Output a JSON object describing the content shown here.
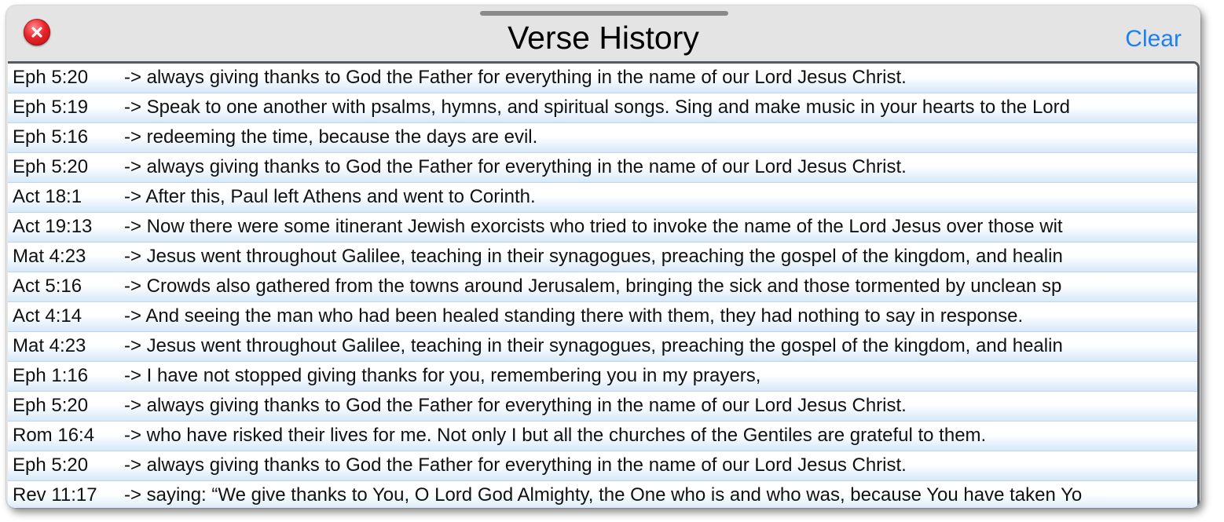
{
  "window": {
    "title": "Verse History",
    "clear_label": "Clear",
    "close_icon": "close-icon",
    "accent_color": "#1e80f0"
  },
  "history": [
    {
      "ref": "Eph 5:20",
      "text": "-> always giving thanks to God the Father for everything in the name of our Lord Jesus Christ."
    },
    {
      "ref": "Eph 5:19",
      "text": "-> Speak to one another with psalms, hymns, and spiritual songs. Sing and make music in your hearts to the Lord"
    },
    {
      "ref": "Eph 5:16",
      "text": "-> redeeming the time, because the days are evil."
    },
    {
      "ref": "Eph 5:20",
      "text": "-> always giving thanks to God the Father for everything in the name of our Lord Jesus Christ."
    },
    {
      "ref": "Act 18:1",
      "text": "-> After this, Paul left Athens and went to Corinth."
    },
    {
      "ref": "Act 19:13",
      "text": "-> Now there were some itinerant Jewish exorcists who tried to invoke the name of the Lord Jesus over those wit"
    },
    {
      "ref": "Mat 4:23",
      "text": "-> Jesus went throughout Galilee, teaching in their synagogues, preaching the gospel of the kingdom, and healin"
    },
    {
      "ref": "Act 5:16",
      "text": "-> Crowds also gathered from the towns around Jerusalem, bringing the sick and those tormented by unclean sp"
    },
    {
      "ref": "Act 4:14",
      "text": "-> And seeing the man who had been healed standing there with them, they had nothing to say in response."
    },
    {
      "ref": "Mat 4:23",
      "text": "-> Jesus went throughout Galilee, teaching in their synagogues, preaching the gospel of the kingdom, and healin"
    },
    {
      "ref": "Eph 1:16",
      "text": "-> I have not stopped giving thanks for you, remembering you in my prayers,"
    },
    {
      "ref": "Eph 5:20",
      "text": "-> always giving thanks to God the Father for everything in the name of our Lord Jesus Christ."
    },
    {
      "ref": "Rom 16:4",
      "text": "-> who have risked their lives for me. Not only I but all the churches of the Gentiles are grateful to them."
    },
    {
      "ref": "Eph 5:20",
      "text": "-> always giving thanks to God the Father for everything in the name of our Lord Jesus Christ."
    },
    {
      "ref": "Rev 11:17",
      "text": "-> saying: “We give thanks to You, O Lord God Almighty, the One who is and who was, because You have taken Yo"
    }
  ]
}
